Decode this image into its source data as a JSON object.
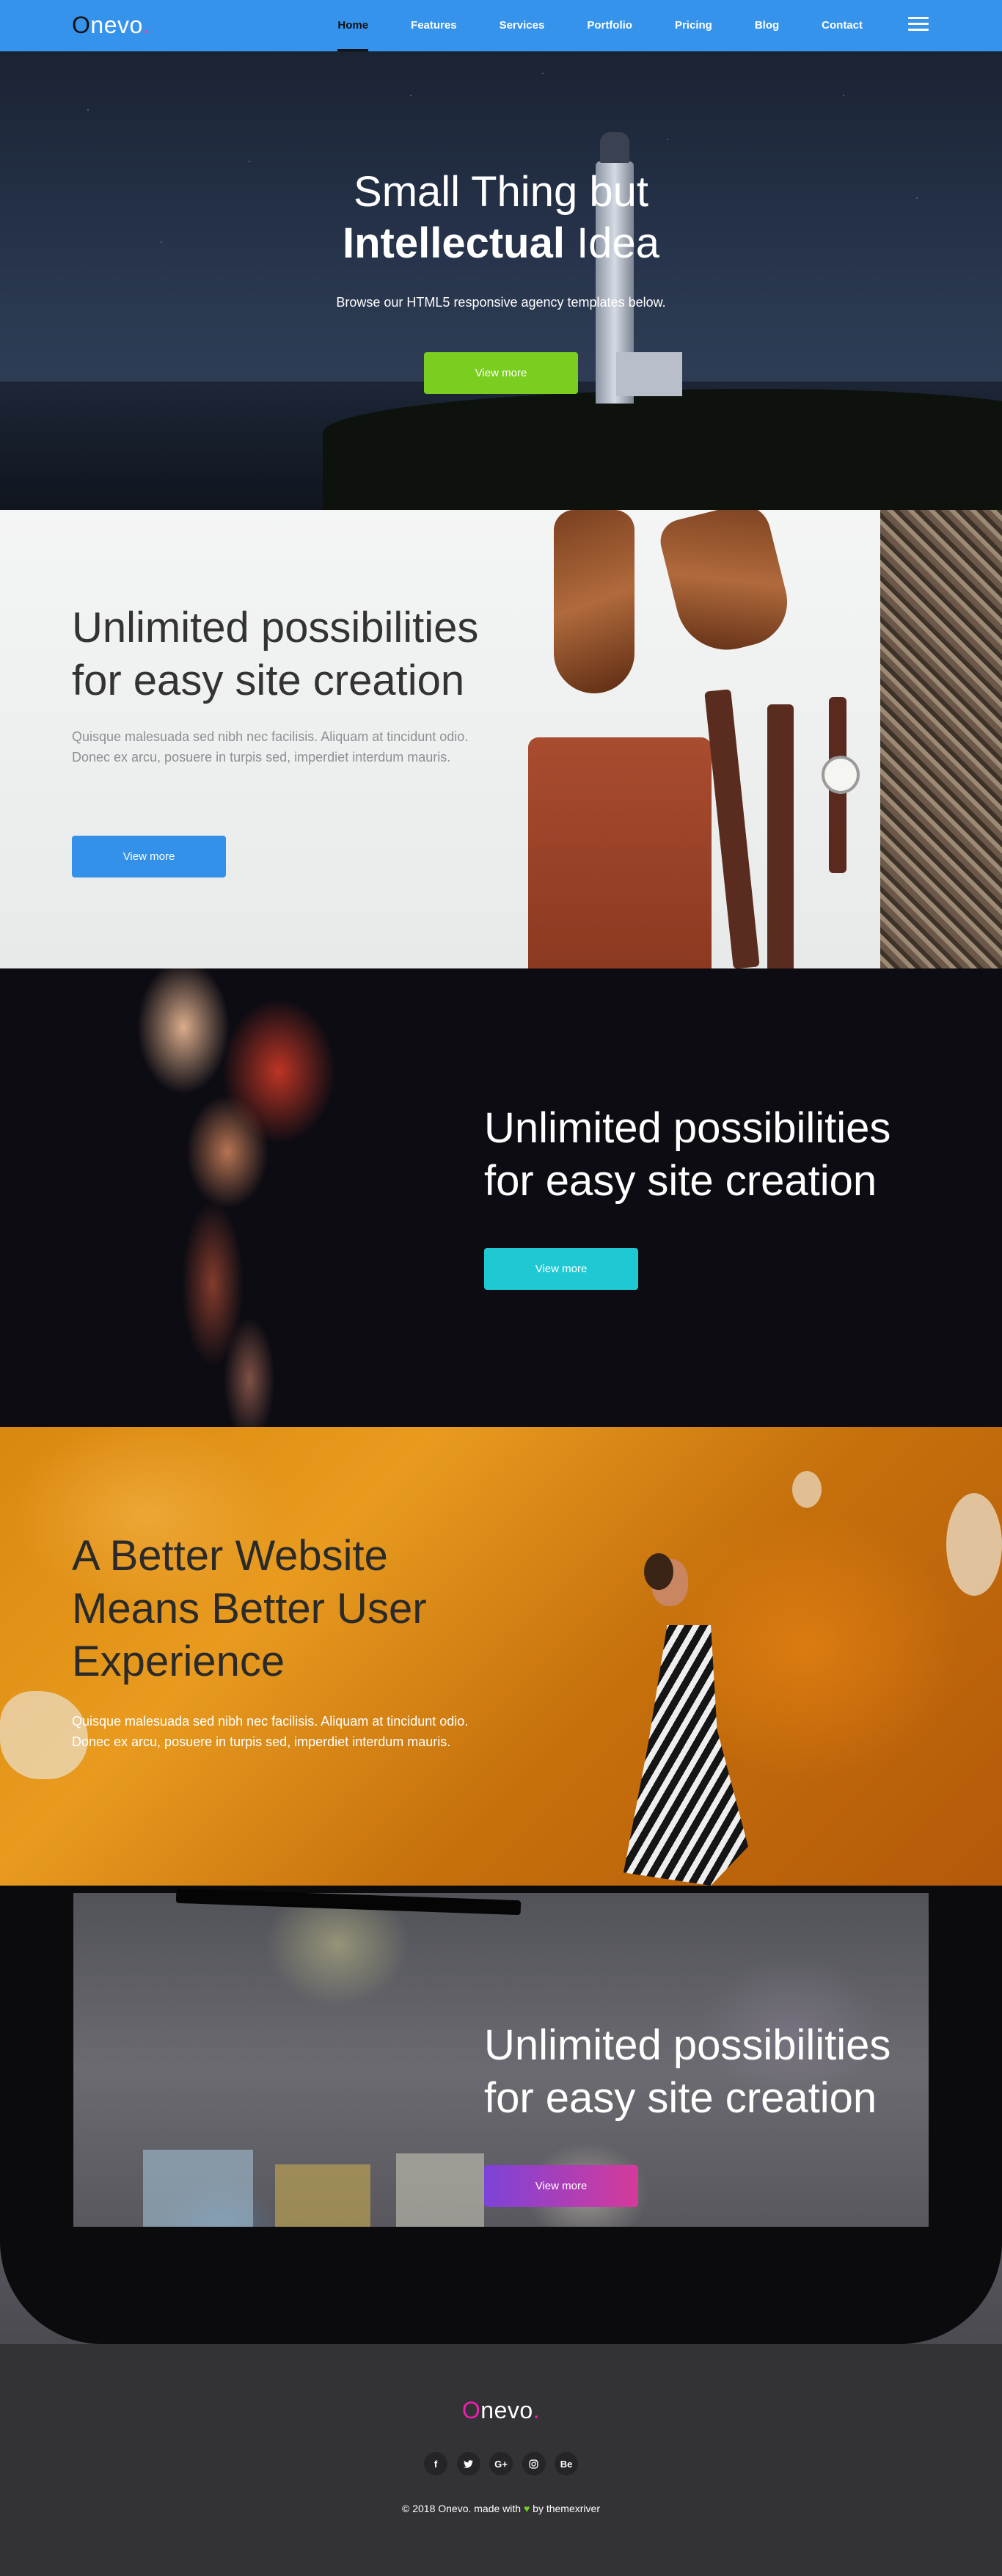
{
  "nav": {
    "logo_first": "O",
    "logo_rest": "nevo",
    "logo_dot": ".",
    "links": [
      "Home",
      "Features",
      "Services",
      "Portfolio",
      "Pricing",
      "Blog",
      "Contact"
    ],
    "active": "Home"
  },
  "hero": {
    "title_line1": "Small Thing but",
    "title_bold": "Intellectual",
    "title_rest": " Idea",
    "subtitle": "Browse our HTML5 responsive agency templates below.",
    "button": "View more",
    "button_color": "#79ce1f"
  },
  "section2": {
    "title_line1": "Unlimited possibilities",
    "title_line2": "for easy site creation",
    "description": "Quisque malesuada sed nibh nec facilisis. Aliquam at tincidunt odio. Donec ex arcu, posuere in turpis sed, imperdiet interdum mauris.",
    "button": "View more",
    "button_color": "#3391e9"
  },
  "section3": {
    "title_line1": "Unlimited possibilities",
    "title_line2": "for easy site creation",
    "button": "View more",
    "button_color": "#1fc9d4"
  },
  "section4": {
    "title_line1": "A Better Website",
    "title_line2": "Means Better User",
    "title_line3": "Experience",
    "description": "Quisque malesuada sed nibh nec facilisis. Aliquam at tincidunt odio. Donec ex arcu, posuere in turpis sed, imperdiet interdum mauris."
  },
  "section5": {
    "title_line1": "Unlimited possibilities",
    "title_line2": "for easy site creation",
    "button": "View more",
    "button_color": "#7c43d8"
  },
  "footer": {
    "logo_first": "O",
    "logo_rest": "nevo",
    "logo_dot": ".",
    "socials": [
      {
        "icon": "facebook-icon",
        "glyph": "f"
      },
      {
        "icon": "twitter-icon",
        "glyph": "🐦"
      },
      {
        "icon": "google-plus-icon",
        "glyph": "G+"
      },
      {
        "icon": "instagram-icon",
        "glyph": "◎"
      },
      {
        "icon": "behance-icon",
        "glyph": "Be"
      }
    ],
    "copy_before": "© 2018 Onevo. made with ",
    "heart": "♥",
    "copy_after": " by themexriver",
    "accent": "#f01eb0"
  }
}
